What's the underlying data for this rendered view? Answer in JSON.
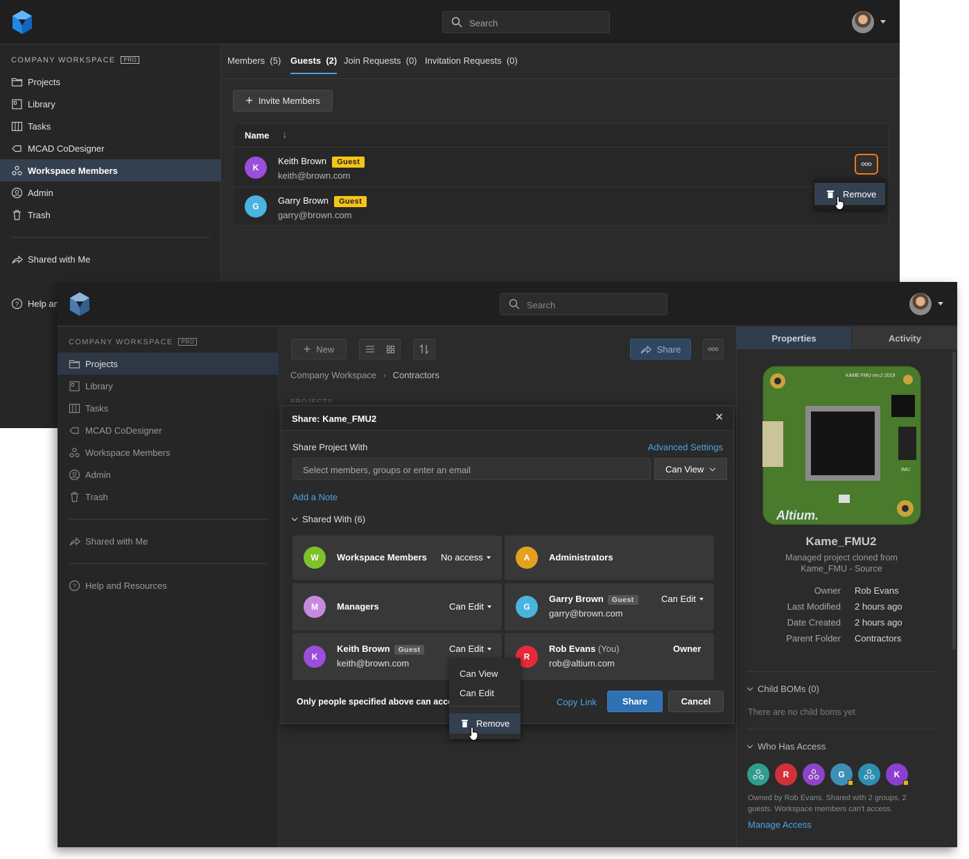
{
  "w1": {
    "search_placeholder": "Search",
    "workspace_label": "COMPANY WORKSPACE",
    "pro": "PRO",
    "nav": [
      "Projects",
      "Library",
      "Tasks",
      "MCAD CoDesigner",
      "Workspace Members",
      "Admin",
      "Trash"
    ],
    "shared": "Shared with Me",
    "help": "Help and Resources",
    "tabs": [
      {
        "label": "Members",
        "count": "(5)"
      },
      {
        "label": "Guests",
        "count": "(2)"
      },
      {
        "label": "Join Requests",
        "count": "(0)"
      },
      {
        "label": "Invitation Requests",
        "count": "(0)"
      }
    ],
    "invite": "Invite Members",
    "col_name": "Name",
    "sort_arrow": "↓",
    "rows": [
      {
        "initial": "K",
        "name": "Keith Brown",
        "badge": "Guest",
        "email": "keith@brown.com",
        "color": "#9b4ddb"
      },
      {
        "initial": "G",
        "name": "Garry Brown",
        "badge": "Guest",
        "email": "garry@brown.com",
        "color": "#4bb3e0"
      }
    ],
    "remove": "Remove"
  },
  "w2": {
    "search_placeholder": "Search",
    "workspace_label": "COMPANY WORKSPACE",
    "pro": "PRO",
    "nav": [
      "Projects",
      "Library",
      "Tasks",
      "MCAD CoDesigner",
      "Workspace Members",
      "Admin",
      "Trash"
    ],
    "shared": "Shared with Me",
    "help": "Help and Resources",
    "toolbar": {
      "new": "New",
      "share": "Share"
    },
    "breadcrumb": [
      "Company Workspace",
      "Contractors"
    ],
    "ghost_text": "PROJECTS",
    "tabs": {
      "properties": "Properties",
      "activity": "Activity"
    },
    "pcb_label": "KAME FMU rev.2 2019",
    "pcb_brand": "Altium.",
    "pcb_imu": "IMU",
    "project": {
      "name": "Kame_FMU2",
      "desc": "Managed project cloned from Kame_FMU - Source",
      "props": [
        {
          "k": "Owner",
          "v": "Rob Evans"
        },
        {
          "k": "Last Modified",
          "v": "2 hours ago"
        },
        {
          "k": "Date Created",
          "v": "2 hours ago"
        },
        {
          "k": "Parent Folder",
          "v": "Contractors"
        }
      ]
    },
    "child_boms": {
      "title": "Child BOMs (0)",
      "empty": "There are no child boms yet"
    },
    "access": {
      "title": "Who Has Access",
      "desc": "Owned by Rob Evans. Shared with 2 groups, 2 guests. Workspace members can't access.",
      "manage": "Manage Access",
      "avatars": [
        {
          "type": "group",
          "color": "#2f9e8f"
        },
        {
          "initial": "R",
          "color": "#d0313a"
        },
        {
          "type": "group",
          "color": "#8e44c8"
        },
        {
          "initial": "G",
          "color": "#3f8fb5",
          "guest": true
        },
        {
          "type": "group",
          "color": "#2d8fb0"
        },
        {
          "initial": "K",
          "color": "#8a3fcf",
          "guest": true
        }
      ]
    },
    "dialog": {
      "title": "Share: Kame_FMU2",
      "share_with": "Share Project With",
      "advanced": "Advanced Settings",
      "input_placeholder": "Select members, groups or enter an email",
      "perm": "Can View",
      "note": "Add a Note",
      "shared_with": "Shared With (6)",
      "entries": [
        {
          "initial": "W",
          "name": "Workspace Members",
          "perm": "No access",
          "color": "#7cc22a"
        },
        {
          "initial": "A",
          "name": "Administrators",
          "perm": "",
          "color": "#e6a020"
        },
        {
          "initial": "M",
          "name": "Managers",
          "perm": "Can Edit",
          "color": "#c58ae0"
        },
        {
          "initial": "G",
          "name": "Garry Brown",
          "badge": "Guest",
          "email": "garry@brown.com",
          "perm": "Can Edit",
          "color": "#4bb3e0"
        },
        {
          "initial": "K",
          "name": "Keith Brown",
          "badge": "Guest",
          "email": "keith@brown.com",
          "perm": "Can Edit",
          "color": "#9b4ddb"
        },
        {
          "initial": "R",
          "name": "Rob Evans",
          "you": "(You)",
          "email": "rob@altium.com",
          "perm": "Owner",
          "color": "#e8293a"
        }
      ],
      "footer_text": "Only people specified above can access",
      "copy_link": "Copy Link",
      "share": "Share",
      "cancel": "Cancel",
      "menu": [
        "Can View",
        "Can Edit",
        "Remove"
      ]
    }
  }
}
